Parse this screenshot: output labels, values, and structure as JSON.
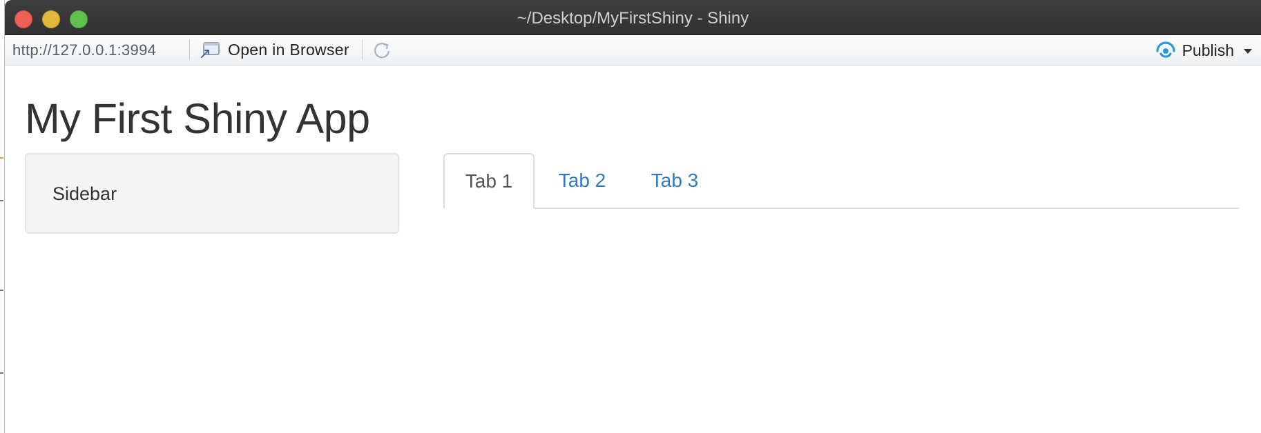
{
  "window": {
    "title": "~/Desktop/MyFirstShiny - Shiny"
  },
  "toolbar": {
    "url": "http://127.0.0.1:3994",
    "open_in_browser_label": "Open in Browser",
    "publish_label": "Publish"
  },
  "app": {
    "title": "My First Shiny App",
    "sidebar_text": "Sidebar",
    "tabs": [
      {
        "label": "Tab 1",
        "active": true
      },
      {
        "label": "Tab 2",
        "active": false
      },
      {
        "label": "Tab 3",
        "active": false
      }
    ]
  },
  "colors": {
    "link": "#337ab7",
    "active_tab_text": "#555555",
    "publish_icon": "#2b9bd6"
  },
  "icons": [
    "open-in-browser-icon",
    "refresh-icon",
    "publish-icon",
    "chevron-down-icon"
  ]
}
